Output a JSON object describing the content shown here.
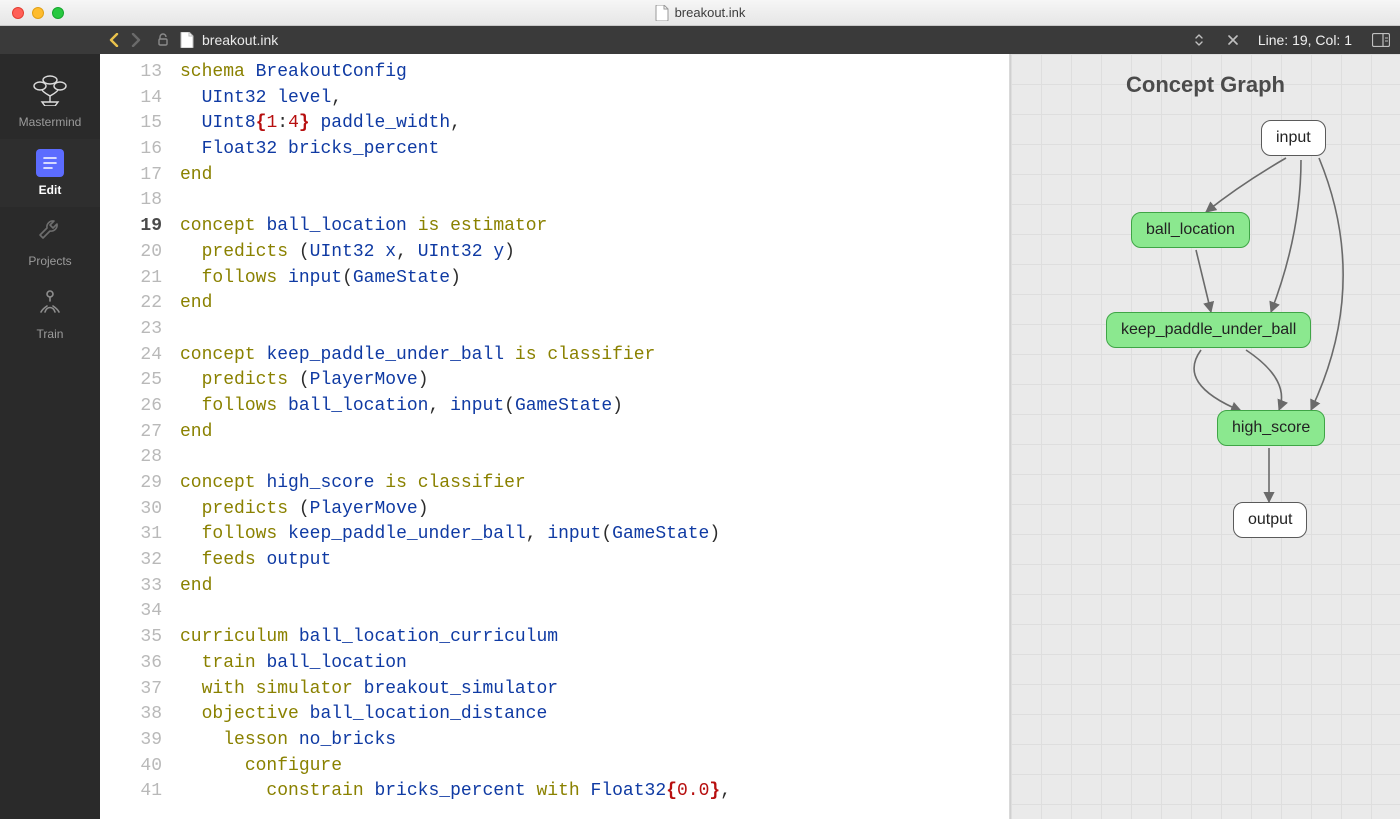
{
  "window": {
    "title": "breakout.ink"
  },
  "toolbar": {
    "filename": "breakout.ink",
    "status": "Line: 19, Col: 1"
  },
  "sidebar": {
    "items": [
      {
        "label": "Mastermind"
      },
      {
        "label": "Edit"
      },
      {
        "label": "Projects"
      },
      {
        "label": "Train"
      }
    ]
  },
  "editor": {
    "first_line": 13,
    "current_line": 19,
    "lines": [
      [
        [
          "kw",
          "schema"
        ],
        [
          " "
        ],
        [
          "type",
          "BreakoutConfig"
        ]
      ],
      [
        [
          "  "
        ],
        [
          "type",
          "UInt32"
        ],
        [
          " "
        ],
        [
          "ident",
          "level"
        ],
        [
          "punct",
          ","
        ]
      ],
      [
        [
          "  "
        ],
        [
          "type",
          "UInt8"
        ],
        [
          "brace",
          "{"
        ],
        [
          "num",
          "1"
        ],
        [
          "punct",
          ":"
        ],
        [
          "num",
          "4"
        ],
        [
          "brace",
          "}"
        ],
        [
          " "
        ],
        [
          "ident",
          "paddle_width"
        ],
        [
          "punct",
          ","
        ]
      ],
      [
        [
          "  "
        ],
        [
          "type",
          "Float32"
        ],
        [
          " "
        ],
        [
          "ident",
          "bricks_percent"
        ]
      ],
      [
        [
          "kw",
          "end"
        ]
      ],
      [
        [
          ""
        ]
      ],
      [
        [
          "kw",
          "concept"
        ],
        [
          " "
        ],
        [
          "ident",
          "ball_location"
        ],
        [
          " "
        ],
        [
          "kw",
          "is"
        ],
        [
          " "
        ],
        [
          "kw",
          "estimator"
        ]
      ],
      [
        [
          "  "
        ],
        [
          "kw",
          "predicts"
        ],
        [
          " "
        ],
        [
          "punct",
          "("
        ],
        [
          "type",
          "UInt32"
        ],
        [
          " "
        ],
        [
          "ident",
          "x"
        ],
        [
          "punct",
          ","
        ],
        [
          " "
        ],
        [
          "type",
          "UInt32"
        ],
        [
          " "
        ],
        [
          "ident",
          "y"
        ],
        [
          "punct",
          ")"
        ]
      ],
      [
        [
          "  "
        ],
        [
          "kw",
          "follows"
        ],
        [
          " "
        ],
        [
          "ident",
          "input"
        ],
        [
          "punct",
          "("
        ],
        [
          "type",
          "GameState"
        ],
        [
          "punct",
          ")"
        ]
      ],
      [
        [
          "kw",
          "end"
        ]
      ],
      [
        [
          ""
        ]
      ],
      [
        [
          "kw",
          "concept"
        ],
        [
          " "
        ],
        [
          "ident",
          "keep_paddle_under_ball"
        ],
        [
          " "
        ],
        [
          "kw",
          "is"
        ],
        [
          " "
        ],
        [
          "kw",
          "classifier"
        ]
      ],
      [
        [
          "  "
        ],
        [
          "kw",
          "predicts"
        ],
        [
          " "
        ],
        [
          "punct",
          "("
        ],
        [
          "type",
          "PlayerMove"
        ],
        [
          "punct",
          ")"
        ]
      ],
      [
        [
          "  "
        ],
        [
          "kw",
          "follows"
        ],
        [
          " "
        ],
        [
          "ident",
          "ball_location"
        ],
        [
          "punct",
          ","
        ],
        [
          " "
        ],
        [
          "ident",
          "input"
        ],
        [
          "punct",
          "("
        ],
        [
          "type",
          "GameState"
        ],
        [
          "punct",
          ")"
        ]
      ],
      [
        [
          "kw",
          "end"
        ]
      ],
      [
        [
          ""
        ]
      ],
      [
        [
          "kw",
          "concept"
        ],
        [
          " "
        ],
        [
          "ident",
          "high_score"
        ],
        [
          " "
        ],
        [
          "kw",
          "is"
        ],
        [
          " "
        ],
        [
          "kw",
          "classifier"
        ]
      ],
      [
        [
          "  "
        ],
        [
          "kw",
          "predicts"
        ],
        [
          " "
        ],
        [
          "punct",
          "("
        ],
        [
          "type",
          "PlayerMove"
        ],
        [
          "punct",
          ")"
        ]
      ],
      [
        [
          "  "
        ],
        [
          "kw",
          "follows"
        ],
        [
          " "
        ],
        [
          "ident",
          "keep_paddle_under_ball"
        ],
        [
          "punct",
          ","
        ],
        [
          " "
        ],
        [
          "ident",
          "input"
        ],
        [
          "punct",
          "("
        ],
        [
          "type",
          "GameState"
        ],
        [
          "punct",
          ")"
        ]
      ],
      [
        [
          "  "
        ],
        [
          "kw",
          "feeds"
        ],
        [
          " "
        ],
        [
          "ident",
          "output"
        ]
      ],
      [
        [
          "kw",
          "end"
        ]
      ],
      [
        [
          ""
        ]
      ],
      [
        [
          "kw",
          "curriculum"
        ],
        [
          " "
        ],
        [
          "ident",
          "ball_location_curriculum"
        ]
      ],
      [
        [
          "  "
        ],
        [
          "kw",
          "train"
        ],
        [
          " "
        ],
        [
          "ident",
          "ball_location"
        ]
      ],
      [
        [
          "  "
        ],
        [
          "kw",
          "with"
        ],
        [
          " "
        ],
        [
          "kw",
          "simulator"
        ],
        [
          " "
        ],
        [
          "ident",
          "breakout_simulator"
        ]
      ],
      [
        [
          "  "
        ],
        [
          "kw",
          "objective"
        ],
        [
          " "
        ],
        [
          "ident",
          "ball_location_distance"
        ]
      ],
      [
        [
          "    "
        ],
        [
          "kw",
          "lesson"
        ],
        [
          " "
        ],
        [
          "ident",
          "no_bricks"
        ]
      ],
      [
        [
          "      "
        ],
        [
          "kw",
          "configure"
        ]
      ],
      [
        [
          "        "
        ],
        [
          "kw",
          "constrain"
        ],
        [
          " "
        ],
        [
          "ident",
          "bricks_percent"
        ],
        [
          " "
        ],
        [
          "kw",
          "with"
        ],
        [
          " "
        ],
        [
          "type",
          "Float32"
        ],
        [
          "brace",
          "{"
        ],
        [
          "num",
          "0.0"
        ],
        [
          "brace",
          "}"
        ],
        [
          "punct",
          ","
        ]
      ]
    ]
  },
  "panel": {
    "title": "Concept Graph",
    "nodes": {
      "input": "input",
      "ball_location": "ball_location",
      "keep_paddle": "keep_paddle_under_ball",
      "high_score": "high_score",
      "output": "output"
    }
  }
}
